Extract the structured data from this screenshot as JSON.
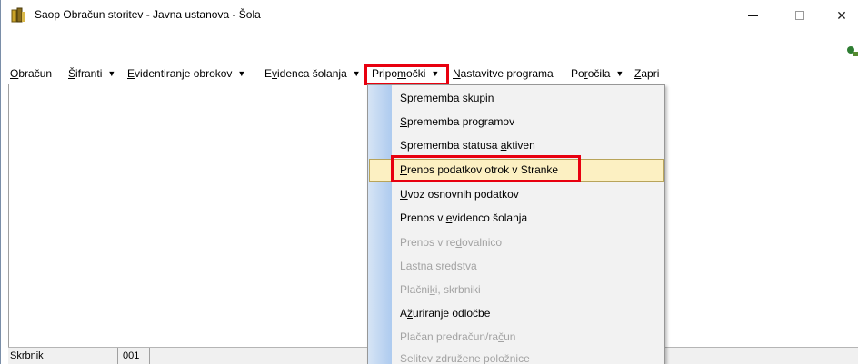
{
  "window": {
    "title": "Saop Obračun storitev - Javna ustanova - Šola"
  },
  "menubar": [
    {
      "pre": "",
      "ul": "O",
      "post": "bračun",
      "arrow": false
    },
    {
      "pre": "",
      "ul": "Š",
      "post": "ifranti",
      "arrow": true
    },
    {
      "pre": "",
      "ul": "E",
      "post": "videntiranje obrokov",
      "arrow": true
    },
    {
      "pre": "E",
      "ul": "v",
      "post": "idenca šolanja",
      "arrow": true
    },
    {
      "pre": "Pripo",
      "ul": "m",
      "post": "očki",
      "arrow": true
    },
    {
      "pre": "",
      "ul": "N",
      "post": "astavitve programa",
      "arrow": false
    },
    {
      "pre": "Po",
      "ul": "r",
      "post": "očila",
      "arrow": true
    },
    {
      "pre": "",
      "ul": "Z",
      "post": "apri",
      "arrow": false
    }
  ],
  "dropdown": [
    {
      "pre": "",
      "ul": "S",
      "post": "prememba skupin",
      "enabled": true
    },
    {
      "pre": "",
      "ul": "S",
      "post": "prememba programov",
      "enabled": true
    },
    {
      "pre": "Sprememba statusa ",
      "ul": "a",
      "post": "ktiven",
      "enabled": true
    },
    {
      "pre": "",
      "ul": "P",
      "post": "renos podatkov otrok v Stranke",
      "enabled": true
    },
    {
      "pre": "",
      "ul": "U",
      "post": "voz osnovnih podatkov",
      "enabled": true
    },
    {
      "pre": "Prenos v ",
      "ul": "e",
      "post": "videnco šolanja",
      "enabled": true
    },
    {
      "pre": "Prenos v re",
      "ul": "d",
      "post": "ovalnico",
      "enabled": false
    },
    {
      "pre": "",
      "ul": "L",
      "post": "astna sredstva",
      "enabled": false
    },
    {
      "pre": "Plačni",
      "ul": "k",
      "post": "i, skrbniki",
      "enabled": false
    },
    {
      "pre": "A",
      "ul": "ž",
      "post": "uriranje odločbe",
      "enabled": true
    },
    {
      "pre": "Plačan predračun/ra",
      "ul": "č",
      "post": "un",
      "enabled": false
    },
    {
      "pre": "Selitev združene položnice",
      "ul": "",
      "post": "",
      "enabled": false
    }
  ],
  "statusbar": {
    "label": "Skrbnik",
    "value": "001"
  },
  "colors": {
    "highlight_border": "#e8000f",
    "hover_bg": "#fcf0c2",
    "selected_menu_bg": "#cce4f7"
  }
}
